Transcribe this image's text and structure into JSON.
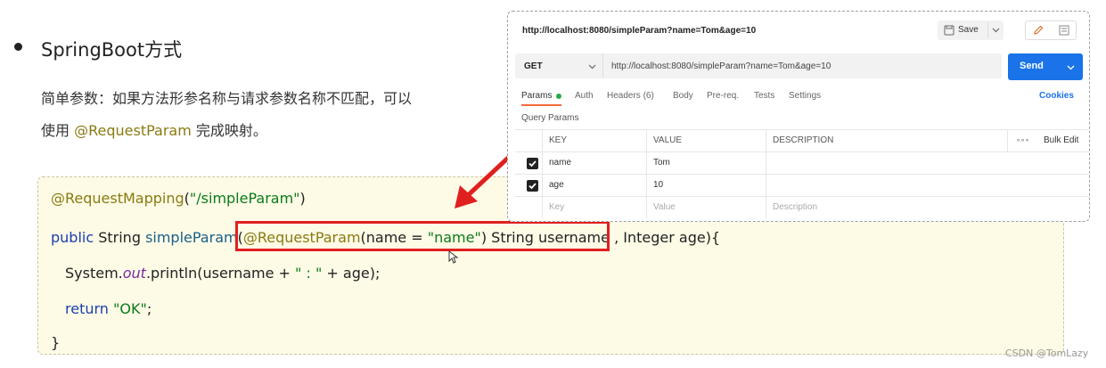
{
  "doc": {
    "heading": "SpringBoot方式",
    "para_line1": "简单参数：如果方法形参名称与请求参数名称不匹配，可以",
    "para_line2_pre": "使用 ",
    "para_line2_highlight": "@RequestParam",
    "para_line2_post": " 完成映射。"
  },
  "code": {
    "line1_ann": "@RequestMapping",
    "line1_rest1": "(",
    "line1_str": "\"/simpleParam\"",
    "line1_rest2": ")",
    "line2_kw": "public",
    "line2_type": " String ",
    "line2_fn": "simpleParam",
    "line2_paren": "(",
    "line2_ann": "@RequestParam",
    "line2_mid": "(name = ",
    "line2_str": "\"name\"",
    "line2_post": ") String username , Integer age){",
    "line3_pre": "System.",
    "line3_ital": "out",
    "line3_mid": ".println(username + ",
    "line3_str": "\" : \"",
    "line3_post": " + age);",
    "line4_kw": "return",
    "line4_str": " \"OK\"",
    "line4_post": ";",
    "line5": "}"
  },
  "postman": {
    "title_url": "http://localhost:8080/simpleParam?name=Tom&age=10",
    "save_label": "Save",
    "method": "GET",
    "url": "http://localhost:8080/simpleParam?name=Tom&age=10",
    "send_label": "Send",
    "tabs": {
      "params": "Params",
      "auth": "Auth",
      "headers": "Headers (6)",
      "body": "Body",
      "prereq": "Pre-req.",
      "tests": "Tests",
      "settings": "Settings"
    },
    "cookies_label": "Cookies",
    "query_params_label": "Query Params",
    "columns": {
      "key": "KEY",
      "value": "VALUE",
      "description": "DESCRIPTION",
      "more": "∘∘∘",
      "bulk_edit": "Bulk Edit"
    },
    "rows": [
      {
        "key": "name",
        "value": "Tom"
      },
      {
        "key": "age",
        "value": "10"
      }
    ],
    "placeholder_row": {
      "key": "Key",
      "value": "Value",
      "description": "Description"
    }
  },
  "watermark": "CSDN @TomLazy",
  "colors": {
    "annotation": "#8a7a12",
    "string": "#0a7a1a",
    "keyword": "#1d3fb0",
    "highlight_box": "#e02020",
    "send_button": "#1a73e8",
    "code_background": "#fdfbe6"
  }
}
